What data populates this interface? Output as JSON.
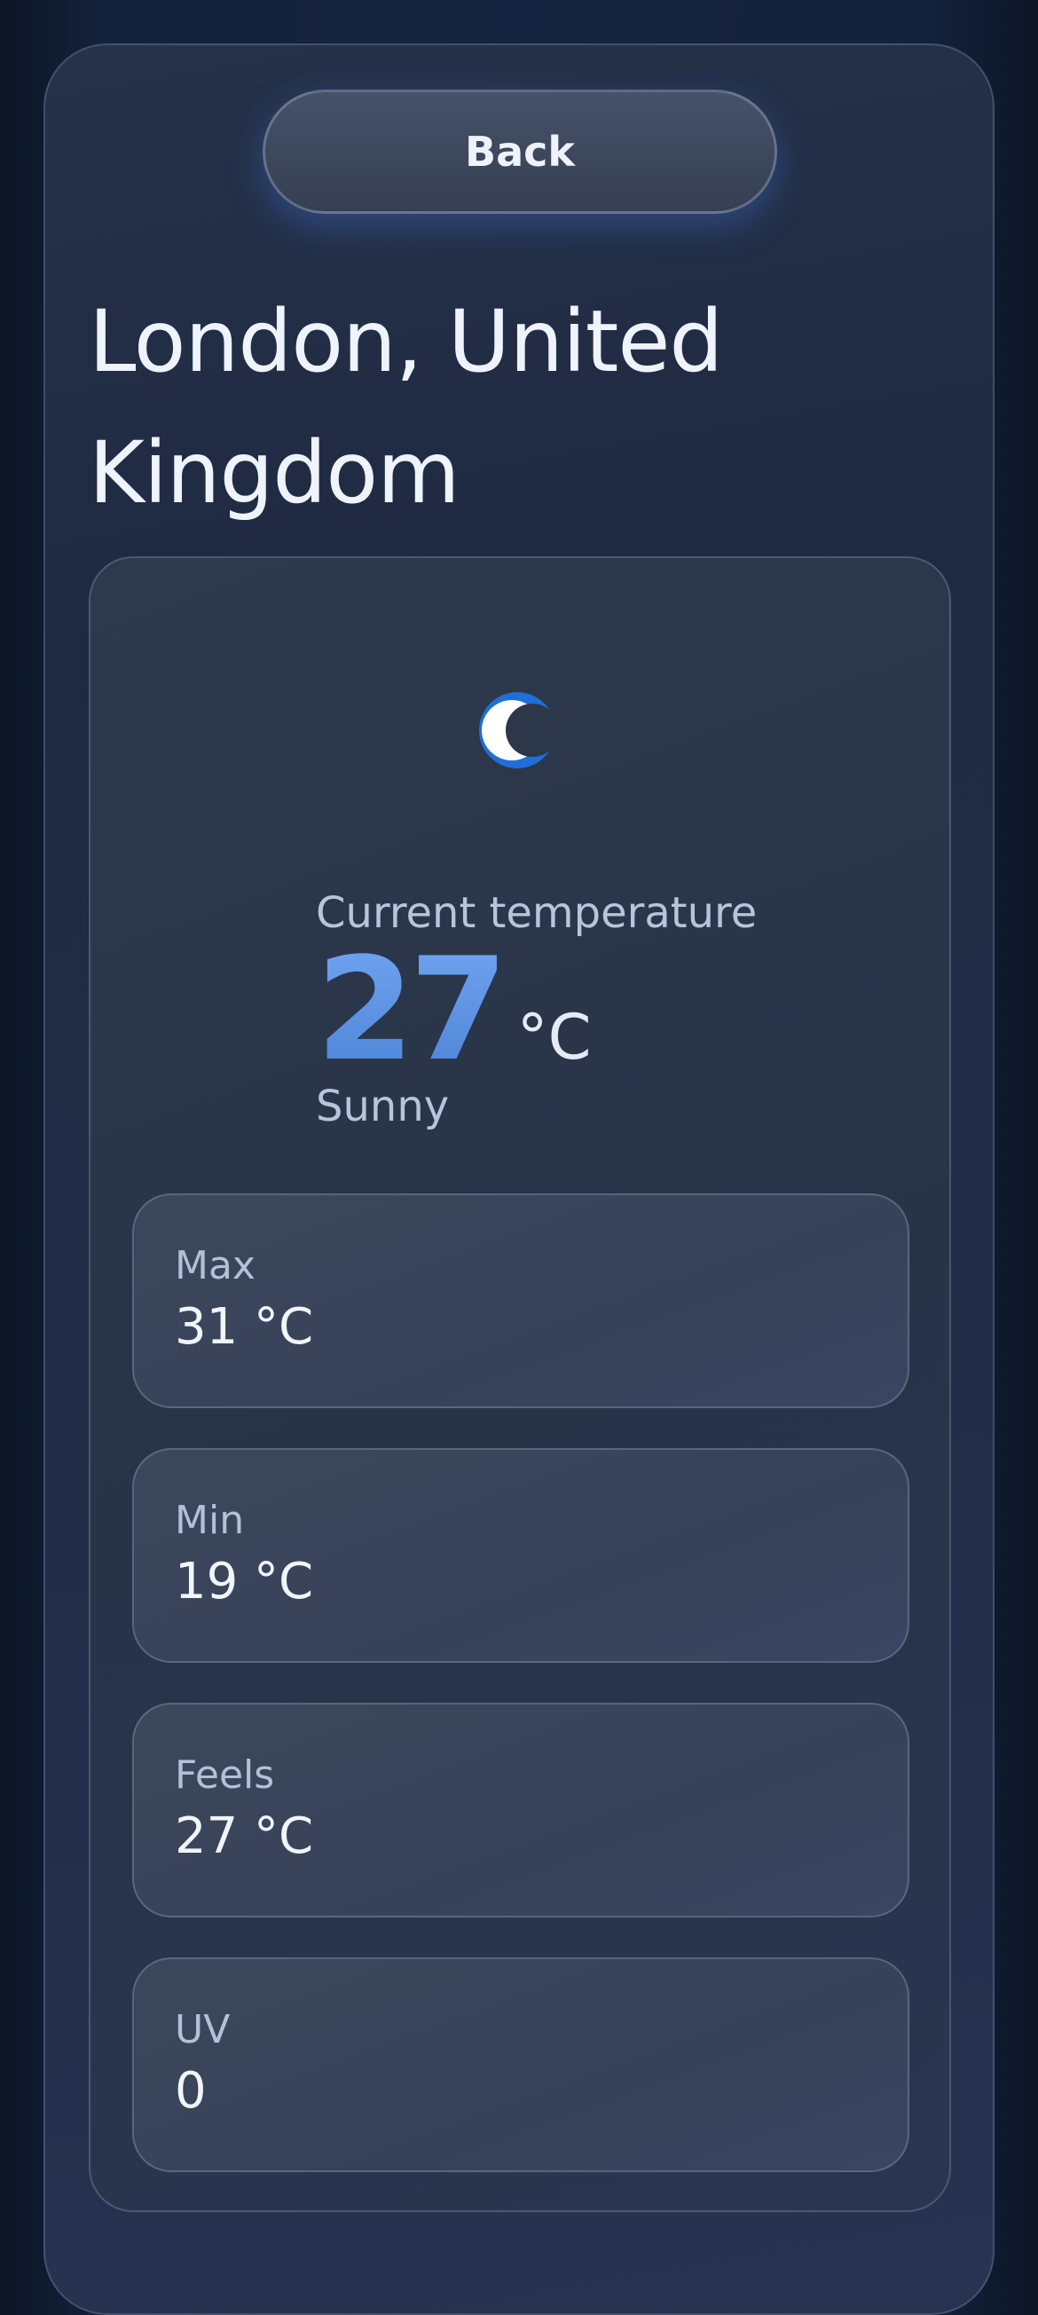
{
  "header": {
    "back_label": "Back"
  },
  "location": {
    "title": "London, United Kingdom"
  },
  "current": {
    "icon": "moon-icon",
    "label": "Current temperature",
    "temperature": "27",
    "unit": "°C",
    "condition": "Sunny"
  },
  "stats": [
    {
      "label": "Max",
      "value": "31 °C"
    },
    {
      "label": "Min",
      "value": "19 °C"
    },
    {
      "label": "Feels",
      "value": "27 °C"
    },
    {
      "label": "UV",
      "value": "0"
    }
  ],
  "colors": {
    "accent": "#5b8fe0",
    "icon_blue": "#1f6fd8"
  }
}
